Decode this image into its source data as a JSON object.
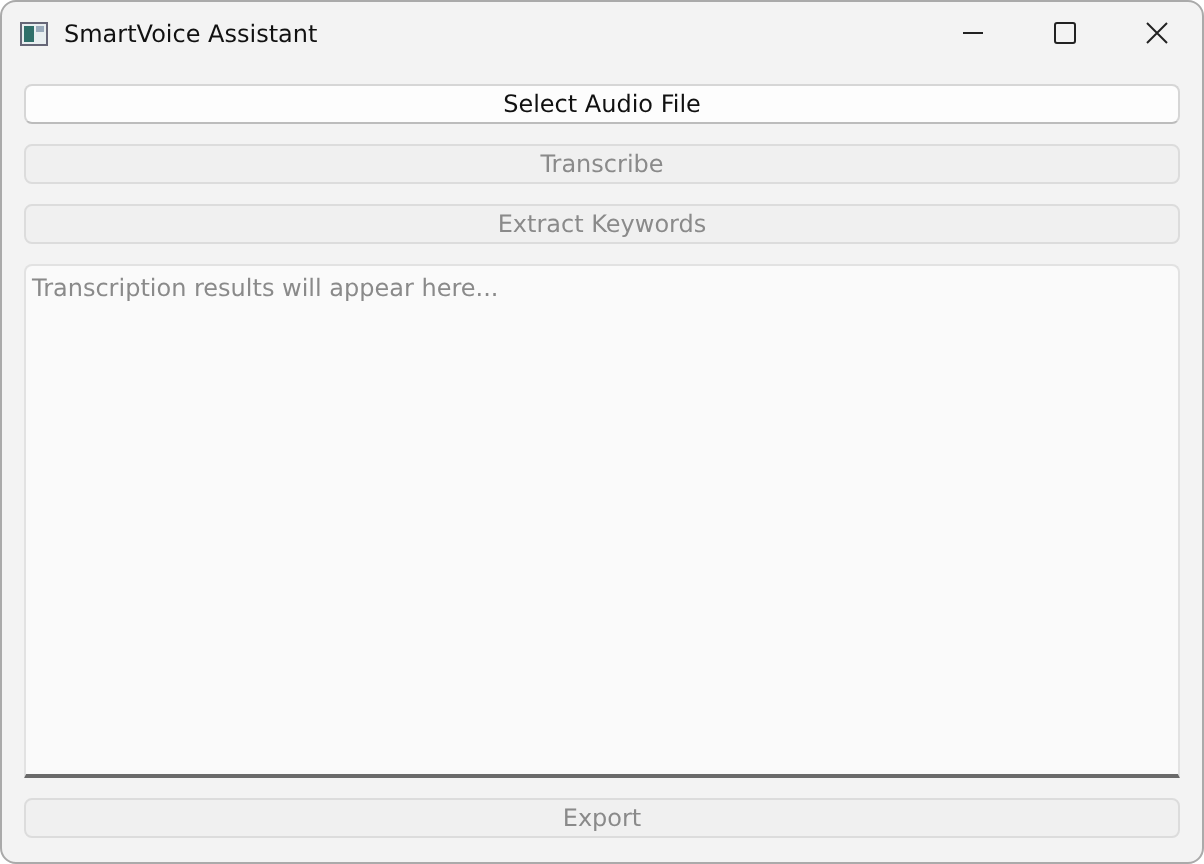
{
  "window": {
    "title": "SmartVoice Assistant"
  },
  "buttons": [
    {
      "label": "Select Audio File",
      "disabled": false
    },
    {
      "label": "Transcribe",
      "disabled": true
    },
    {
      "label": "Extract Keywords",
      "disabled": true
    }
  ],
  "results": {
    "placeholder": "Transcription results will appear here..."
  },
  "export_button": {
    "label": "Export",
    "disabled": true
  }
}
